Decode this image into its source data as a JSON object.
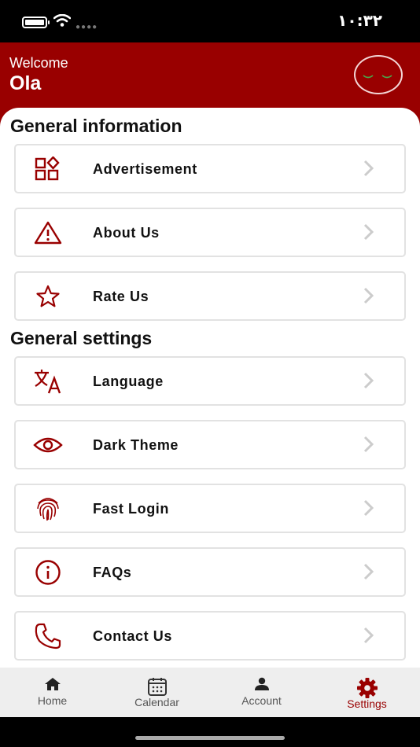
{
  "status_bar": {
    "time": "١٠:٣٢"
  },
  "header": {
    "welcome": "Welcome",
    "user_name": "Ola"
  },
  "sections": {
    "general_information": "General information",
    "general_settings": "General settings"
  },
  "menu": {
    "advertisement": "Advertisement",
    "about_us": "About Us",
    "rate_us": "Rate Us",
    "language": "Language",
    "dark_theme": "Dark Theme",
    "fast_login": "Fast Login",
    "faqs": "FAQs",
    "contact_us": "Contact Us"
  },
  "tabs": {
    "home": "Home",
    "calendar": "Calendar",
    "account": "Account",
    "settings": "Settings"
  },
  "colors": {
    "brand": "#990000",
    "tab_active": "#990000",
    "tab_inactive": "#555555"
  }
}
